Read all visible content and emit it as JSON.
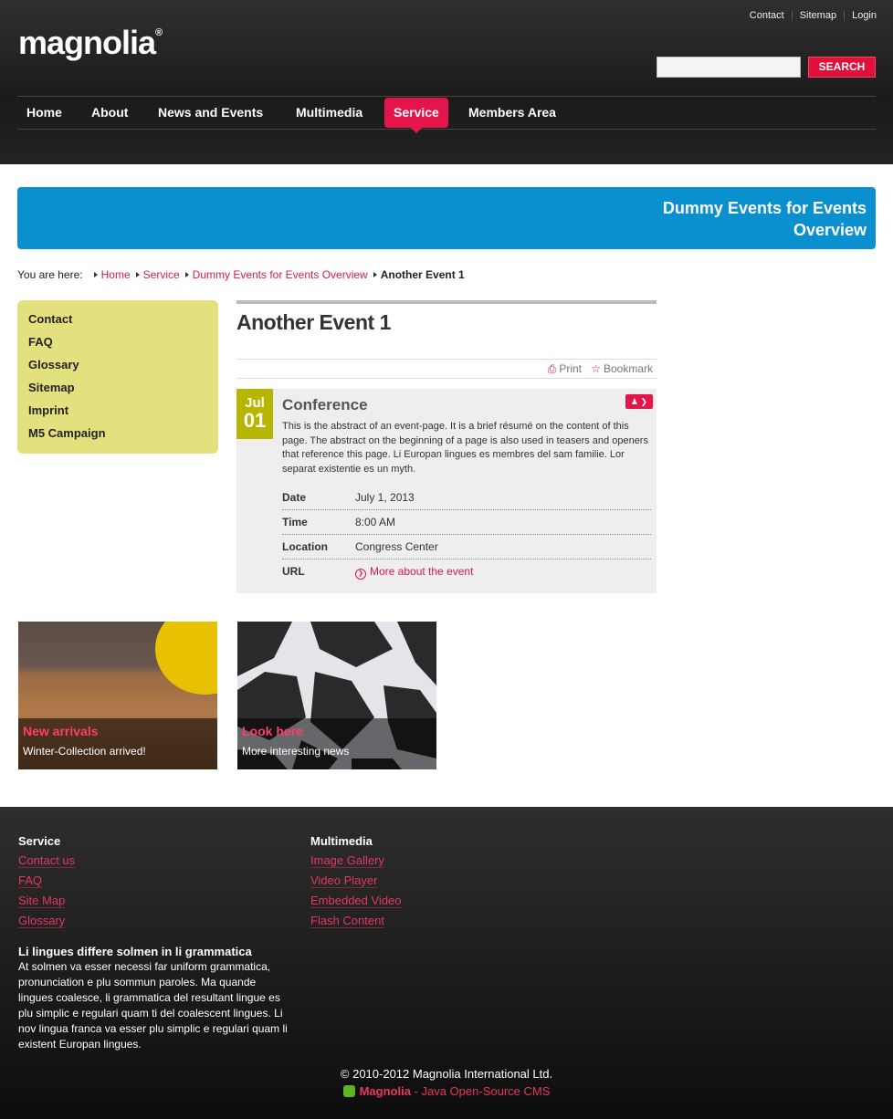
{
  "header": {
    "logo": "magnolia",
    "logo_mark": "®",
    "meta_links": [
      "Contact",
      "Sitemap",
      "Login"
    ],
    "search": {
      "value": "",
      "placeholder": "",
      "button": "SEARCH"
    },
    "nav": [
      {
        "label": "Home",
        "active": false
      },
      {
        "label": "About",
        "active": false
      },
      {
        "label": "News and Events",
        "active": false
      },
      {
        "label": "Multimedia",
        "active": false
      },
      {
        "label": "Service",
        "active": true
      },
      {
        "label": "Members Area",
        "active": false
      }
    ]
  },
  "banner": {
    "title": "Dummy Events for Events Overview"
  },
  "breadcrumb": {
    "label": "You are here:",
    "items": [
      "Home",
      "Service",
      "Dummy Events for Events Overview"
    ],
    "current": "Another Event 1"
  },
  "sidebar": {
    "items": [
      "Contact",
      "FAQ",
      "Glossary",
      "Sitemap",
      "Imprint",
      "M5 Campaign"
    ]
  },
  "main": {
    "title": "Another Event 1",
    "tools": {
      "print": "Print",
      "bookmark": "Bookmark"
    },
    "event": {
      "month": "Jul",
      "day": "01",
      "title": "Conference",
      "abstract": "This is the abstract of an event-page. It is a brief résumé on the content of this page. The abstract on the beginning of a page is also used in teasers and openers that reference this page. Li Europan lingues es membres del sam familie. Lor separat existentie es un myth.",
      "rows": [
        {
          "label": "Date",
          "value": "July 1, 2013"
        },
        {
          "label": "Time",
          "value": "8:00 AM"
        },
        {
          "label": "Location",
          "value": "Congress Center"
        },
        {
          "label": "URL",
          "value": "More about the event"
        }
      ]
    }
  },
  "teasers": [
    {
      "title": "New arrivals",
      "text": "Winter-Collection arrived!"
    },
    {
      "title": "Look here",
      "text": "More interesting news"
    }
  ],
  "footer": {
    "columns": [
      {
        "title": "Service",
        "links": [
          "Contact us",
          "FAQ",
          "Site Map",
          "Glossary"
        ]
      },
      {
        "title": "Multimedia",
        "links": [
          "Image Gallery",
          "Video Player",
          "Embedded Video",
          "Flash Content"
        ]
      }
    ],
    "text_title": "Li lingues differe solmen in li grammatica",
    "text_body": "At solmen va esser necessi far uniform grammatica, pronunciation e plu sommun paroles. Ma quande lingues coalesce, li grammatica del resultant lingue es plu simplic e regulari quam ti del coalescent lingues. Li nov lingua franca va esser plu simplic e regulari quam li existent Europan lingues.",
    "copyright": "© 2010-2012 Magnolia International Ltd.",
    "powered_brand": "Magnolia",
    "powered_text": " - Java Open-Source CMS"
  },
  "colors": {
    "accent": "#e4154a",
    "banner": "#0a8fcf",
    "sidebar": "#e3e17d",
    "date_badge": "#b6b600"
  }
}
